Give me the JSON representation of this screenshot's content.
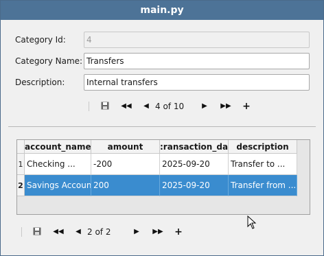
{
  "window": {
    "title": "main.py"
  },
  "form": {
    "category_id": {
      "label": "Category Id:",
      "value": "4"
    },
    "category_name": {
      "label": "Category Name:",
      "value": "Transfers"
    },
    "description": {
      "label": "Description:",
      "value": "Internal transfers"
    }
  },
  "form_nav": {
    "position": "4 of 10",
    "save_icon": "save-icon",
    "first_icon": "first-icon",
    "prev_icon": "prev-icon",
    "next_icon": "next-icon",
    "last_icon": "last-icon",
    "add_icon": "add-icon"
  },
  "table": {
    "columns": [
      "account_name",
      "amount",
      ":ransaction_date",
      "description"
    ],
    "rows": [
      {
        "index": "1",
        "cells": [
          "Checking ...",
          "-200",
          "2025-09-20",
          "Transfer to ..."
        ],
        "selected": false
      },
      {
        "index": "2",
        "cells": [
          "Savings Account",
          "200",
          "2025-09-20",
          "Transfer from ..."
        ],
        "selected": true
      }
    ]
  },
  "table_nav": {
    "position": "2 of 2"
  },
  "glyphs": {
    "save": "💾",
    "first": "◀◀",
    "prev": "◀",
    "next": "▶",
    "last": "▶▶",
    "add": "+"
  },
  "colors": {
    "titlebar": "#4d7397",
    "selection": "#3a8ccf"
  }
}
